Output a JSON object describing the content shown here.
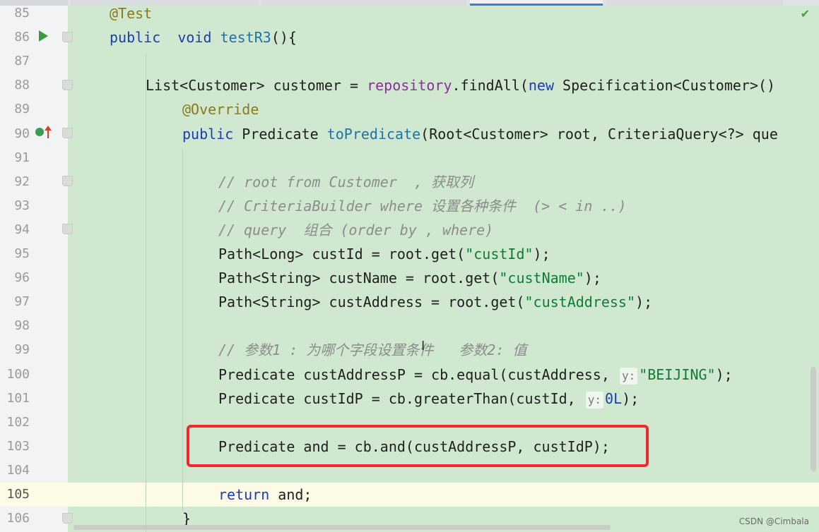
{
  "editor": {
    "lines": [
      {
        "num": "85",
        "indent": 155,
        "parts": [
          {
            "t": "@Test",
            "c": "ann"
          }
        ]
      },
      {
        "num": "86",
        "indent": 155,
        "parts": [
          {
            "t": "public",
            "c": "kw"
          },
          {
            "t": "  "
          },
          {
            "t": "void",
            "c": "kw"
          },
          {
            "t": " "
          },
          {
            "t": "testR3",
            "c": "fn"
          },
          {
            "t": "(){"
          }
        ]
      },
      {
        "num": "87",
        "indent": 155,
        "parts": []
      },
      {
        "num": "88",
        "indent": 206,
        "parts": [
          {
            "t": "List<Customer> customer = "
          },
          {
            "t": "repository",
            "c": "field"
          },
          {
            "t": ".findAll("
          },
          {
            "t": "new",
            "c": "kw"
          },
          {
            "t": " Specification<Customer>()"
          }
        ]
      },
      {
        "num": "89",
        "indent": 258,
        "parts": [
          {
            "t": "@Override",
            "c": "ann"
          }
        ]
      },
      {
        "num": "90",
        "indent": 258,
        "parts": [
          {
            "t": "public",
            "c": "kw"
          },
          {
            "t": " Predicate "
          },
          {
            "t": "toPredicate",
            "c": "fn"
          },
          {
            "t": "(Root<Customer> root, CriteriaQuery<?> que"
          }
        ]
      },
      {
        "num": "91",
        "indent": 258,
        "parts": []
      },
      {
        "num": "92",
        "indent": 309,
        "parts": [
          {
            "t": "// root from Customer  , 获取列",
            "c": "cmt"
          }
        ]
      },
      {
        "num": "93",
        "indent": 309,
        "parts": [
          {
            "t": "// CriteriaBuilder where 设置各种条件  (> < in ..)",
            "c": "cmt"
          }
        ]
      },
      {
        "num": "94",
        "indent": 309,
        "parts": [
          {
            "t": "// query  组合 (order by , where)",
            "c": "cmt"
          }
        ]
      },
      {
        "num": "95",
        "indent": 309,
        "parts": [
          {
            "t": "Path<Long> custId = root.get("
          },
          {
            "t": "\"custId\"",
            "c": "str"
          },
          {
            "t": ");"
          }
        ]
      },
      {
        "num": "96",
        "indent": 309,
        "parts": [
          {
            "t": "Path<String> custName = root.get("
          },
          {
            "t": "\"custName\"",
            "c": "str"
          },
          {
            "t": ");"
          }
        ]
      },
      {
        "num": "97",
        "indent": 309,
        "parts": [
          {
            "t": "Path<String> custAddress = root.get("
          },
          {
            "t": "\"custAddress\"",
            "c": "str"
          },
          {
            "t": ");"
          }
        ]
      },
      {
        "num": "98",
        "indent": 309,
        "parts": []
      },
      {
        "num": "99",
        "indent": 309,
        "parts": [
          {
            "t": "// 参数1 : 为哪个字段设置条件   参数2: 值",
            "c": "cmt"
          }
        ]
      },
      {
        "num": "100",
        "indent": 309,
        "parts": [
          {
            "t": "Predicate custAddressP = cb.equal(custAddress, "
          },
          {
            "t": "y:",
            "c": "hint"
          },
          {
            "t": "\"BEIJING\"",
            "c": "str"
          },
          {
            "t": ");"
          }
        ]
      },
      {
        "num": "101",
        "indent": 309,
        "parts": [
          {
            "t": "Predicate custIdP = cb.greaterThan(custId, "
          },
          {
            "t": "y:",
            "c": "hint"
          },
          {
            "t": "0L",
            "c": "num"
          },
          {
            "t": ");"
          }
        ]
      },
      {
        "num": "102",
        "indent": 309,
        "parts": []
      },
      {
        "num": "103",
        "indent": 309,
        "parts": [
          {
            "t": "Predicate and = cb.and(custAddressP, custIdP);"
          }
        ]
      },
      {
        "num": "104",
        "indent": 309,
        "parts": []
      },
      {
        "num": "105",
        "indent": 309,
        "current": true,
        "parts": [
          {
            "t": "return",
            "c": "kw"
          },
          {
            "t": " and;"
          }
        ]
      },
      {
        "num": "106",
        "indent": 258,
        "parts": [
          {
            "t": "}"
          }
        ]
      }
    ]
  },
  "icons": {
    "run": "run-gutter-icon",
    "implements": "implements-icon",
    "override_arrow": "override-arrow-icon",
    "inspection_ok": "check-icon"
  },
  "colors": {
    "code_background": "#cfe8cf",
    "highlight_box": "#f1272b",
    "current_line": "#fdfbe6"
  },
  "watermark": "CSDN @Cimbala"
}
